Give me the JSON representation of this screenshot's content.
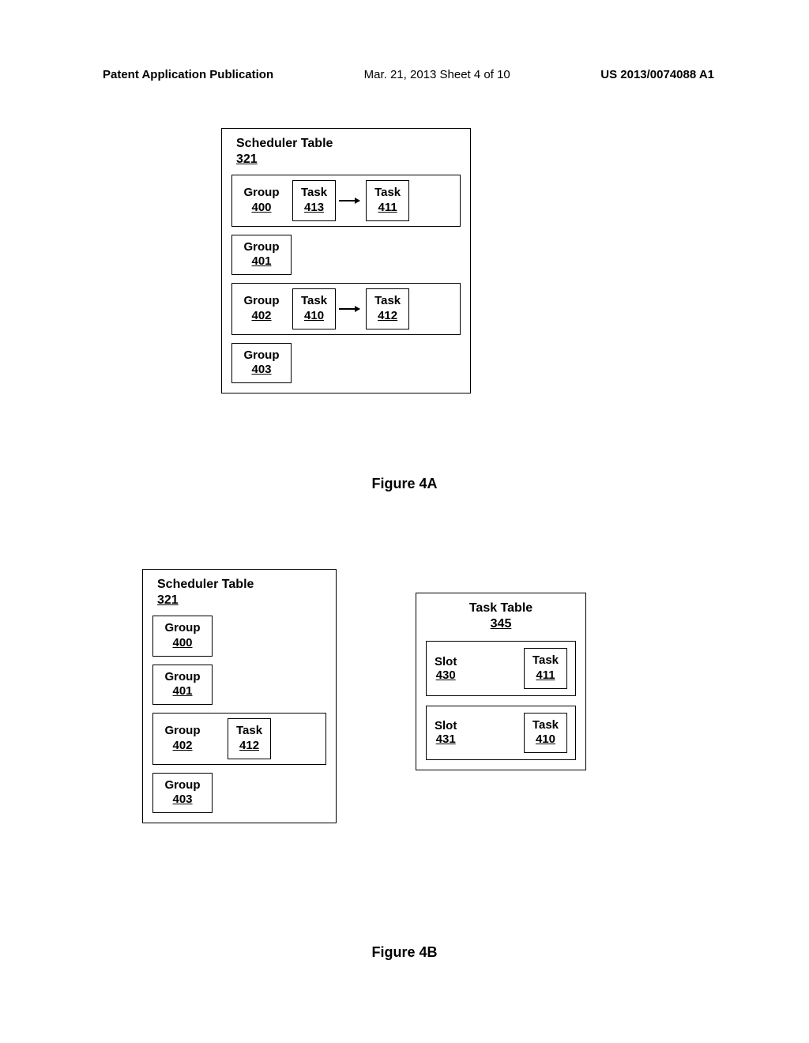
{
  "header": {
    "left": "Patent Application Publication",
    "center": "Mar. 21, 2013  Sheet 4 of 10",
    "right": "US 2013/0074088 A1"
  },
  "fig4a": {
    "label": "Figure 4A",
    "scheduler": {
      "title": "Scheduler Table",
      "ref": "321",
      "rows": [
        {
          "group": "Group",
          "groupRef": "400",
          "tasks": [
            {
              "label": "Task",
              "ref": "413"
            },
            {
              "label": "Task",
              "ref": "411"
            }
          ]
        },
        {
          "group": "Group",
          "groupRef": "401",
          "tasks": []
        },
        {
          "group": "Group",
          "groupRef": "402",
          "tasks": [
            {
              "label": "Task",
              "ref": "410"
            },
            {
              "label": "Task",
              "ref": "412"
            }
          ]
        },
        {
          "group": "Group",
          "groupRef": "403",
          "tasks": []
        }
      ]
    }
  },
  "fig4b": {
    "label": "Figure 4B",
    "scheduler": {
      "title": "Scheduler Table",
      "ref": "321",
      "rows": [
        {
          "group": "Group",
          "groupRef": "400",
          "tasks": []
        },
        {
          "group": "Group",
          "groupRef": "401",
          "tasks": []
        },
        {
          "group": "Group",
          "groupRef": "402",
          "tasks": [
            {
              "label": "Task",
              "ref": "412"
            }
          ]
        },
        {
          "group": "Group",
          "groupRef": "403",
          "tasks": []
        }
      ]
    },
    "taskTable": {
      "title": "Task Table",
      "ref": "345",
      "rows": [
        {
          "slot": "Slot",
          "slotRef": "430",
          "task": {
            "label": "Task",
            "ref": "411"
          }
        },
        {
          "slot": "Slot",
          "slotRef": "431",
          "task": {
            "label": "Task",
            "ref": "410"
          }
        }
      ]
    }
  }
}
